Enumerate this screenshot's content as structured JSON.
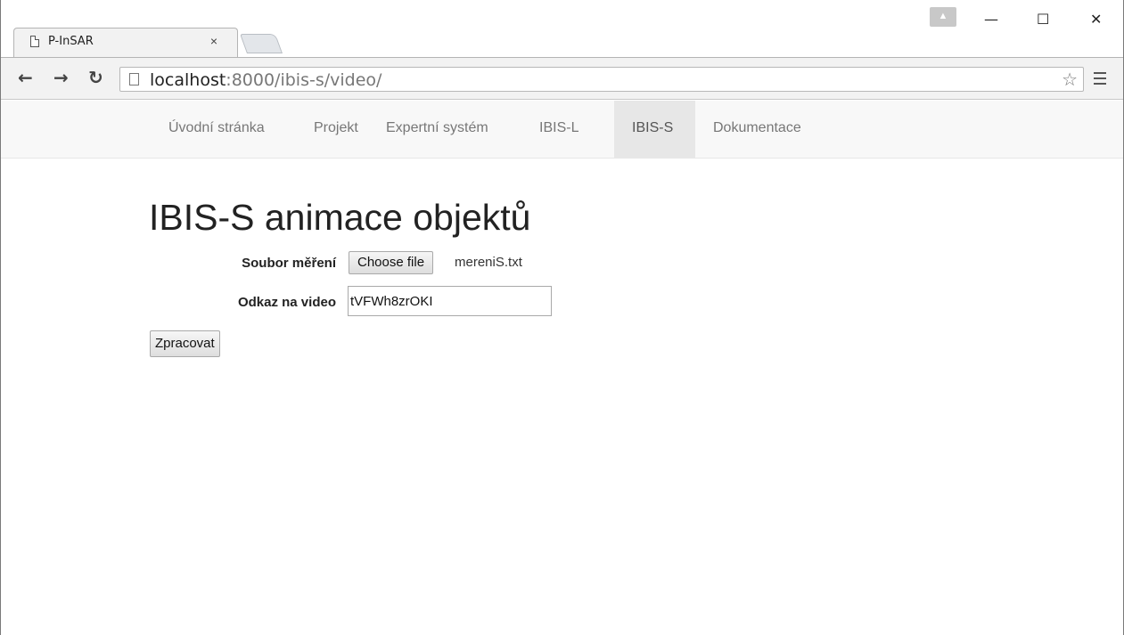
{
  "browser": {
    "tab_title": "P-InSAR",
    "tab_close": "×",
    "url_host": "localhost",
    "url_path": ":8000/ibis-s/video/",
    "window_controls": {
      "minimize": "—",
      "maximize": "☐",
      "close": "✕"
    }
  },
  "navbar": {
    "items": [
      "Úvodní stránka",
      "Projekt",
      "Expertní systém",
      "IBIS-L",
      "IBIS-S",
      "Dokumentace"
    ],
    "active": "IBIS-S"
  },
  "page": {
    "title": "IBIS-S animace objektů",
    "file_label": "Soubor měření",
    "file_button": "Choose file",
    "file_name": "mereniS.txt",
    "video_label": "Odkaz na video",
    "video_value": "tVFWh8zrOKI",
    "submit_label": "Zpracovat"
  },
  "icons": [
    "page-icon",
    "back-arrow-icon",
    "forward-arrow-icon",
    "reload-icon",
    "star-icon",
    "menu-icon",
    "profile-icon"
  ]
}
